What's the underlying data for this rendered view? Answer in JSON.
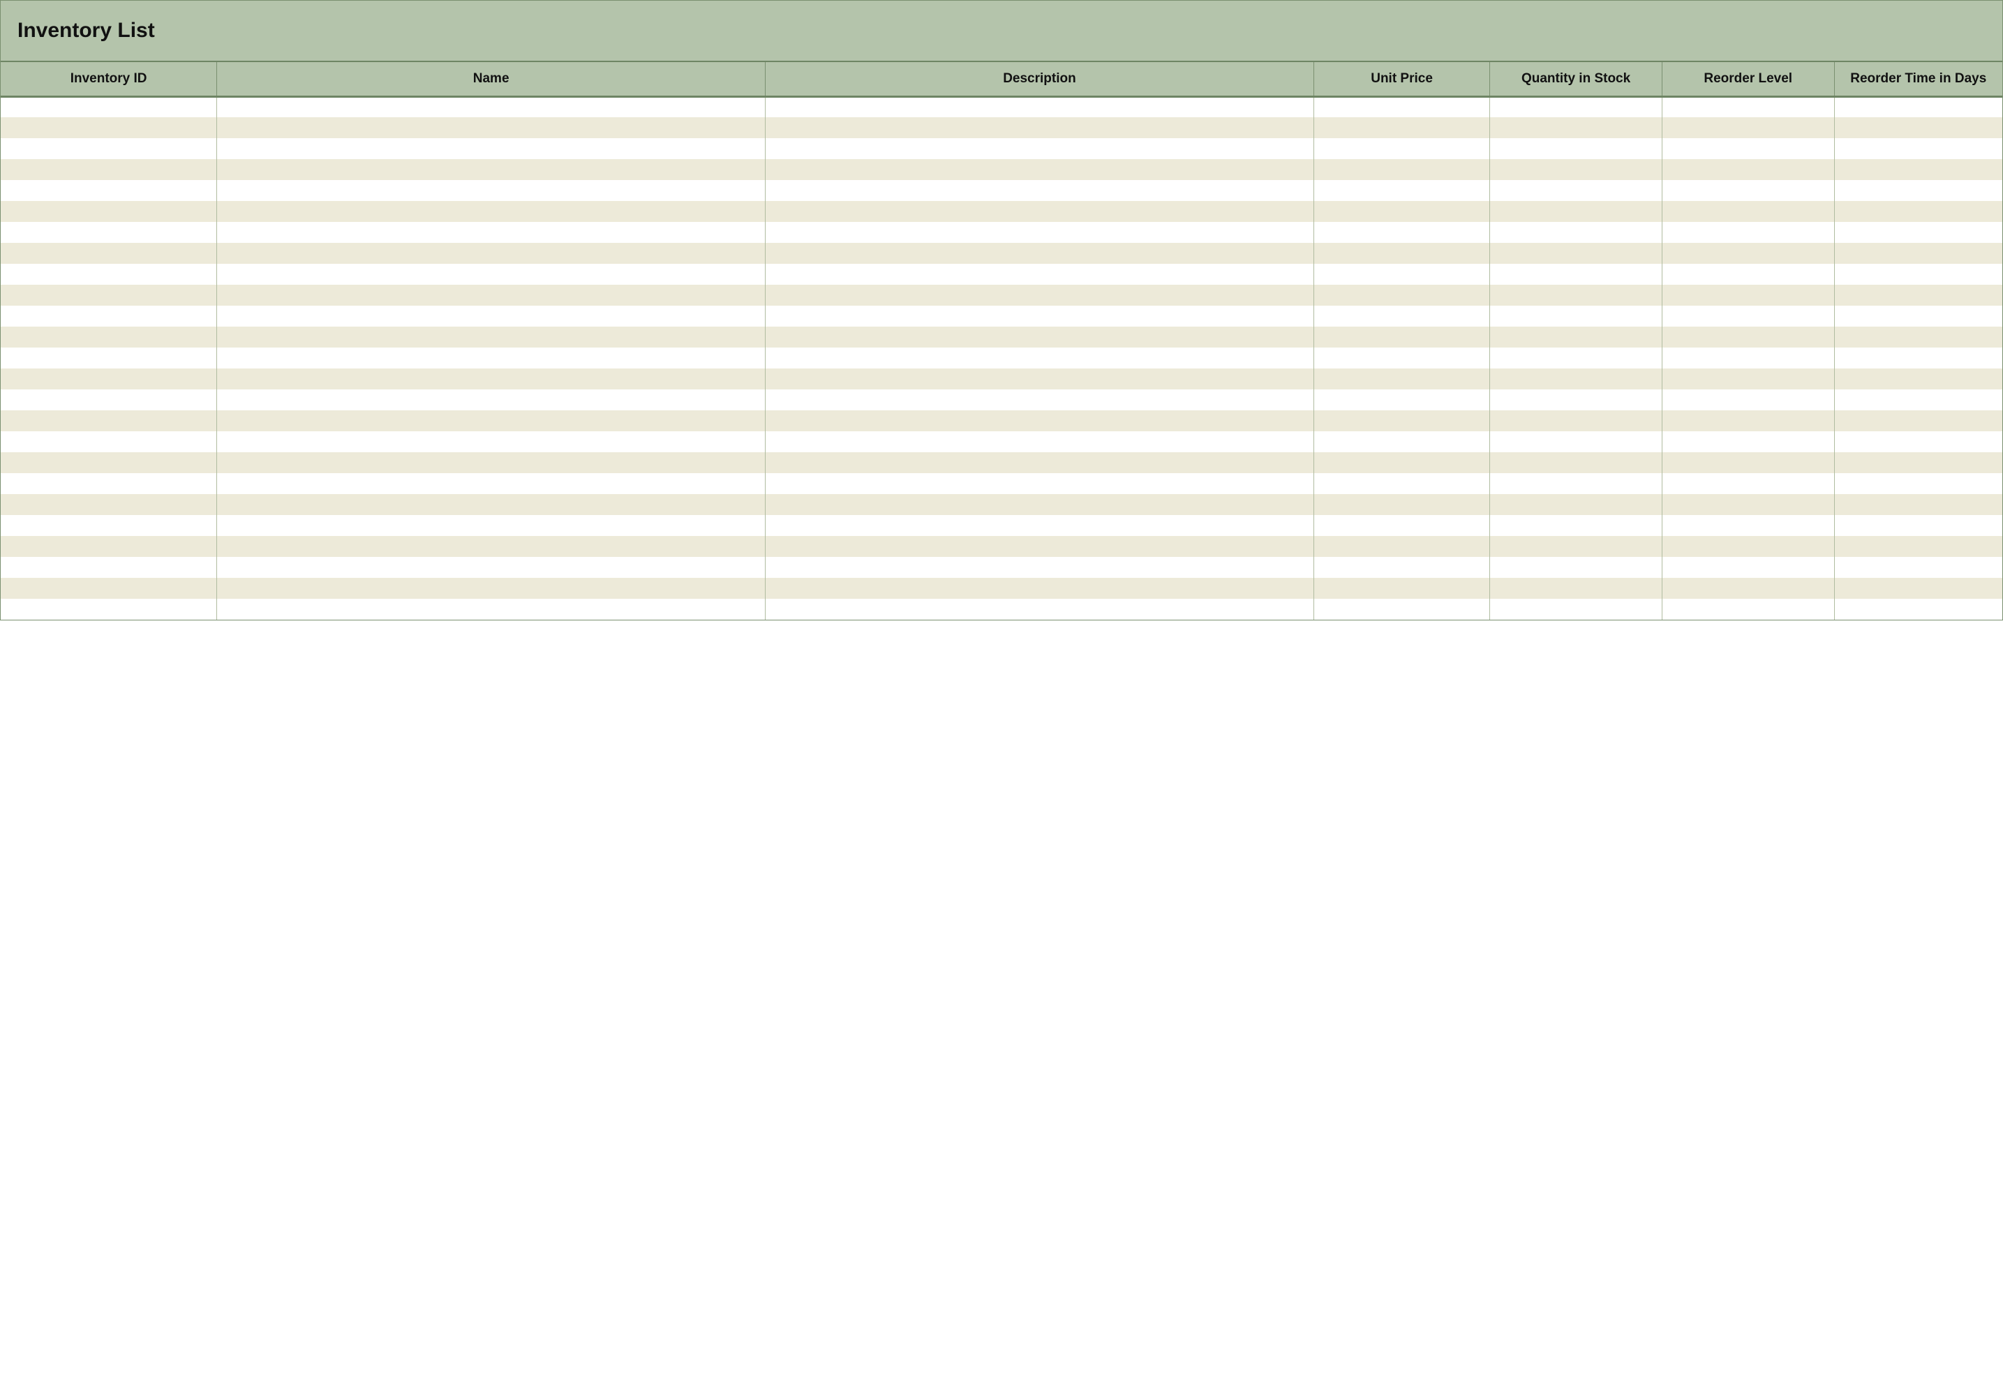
{
  "title": "Inventory List",
  "columns": [
    "Inventory ID",
    "Name",
    "Description",
    "Unit Price",
    "Quantity in Stock",
    "Reorder Level",
    "Reorder Time in Days"
  ],
  "rows": [
    [
      "",
      "",
      "",
      "",
      "",
      "",
      ""
    ],
    [
      "",
      "",
      "",
      "",
      "",
      "",
      ""
    ],
    [
      "",
      "",
      "",
      "",
      "",
      "",
      ""
    ],
    [
      "",
      "",
      "",
      "",
      "",
      "",
      ""
    ],
    [
      "",
      "",
      "",
      "",
      "",
      "",
      ""
    ],
    [
      "",
      "",
      "",
      "",
      "",
      "",
      ""
    ],
    [
      "",
      "",
      "",
      "",
      "",
      "",
      ""
    ],
    [
      "",
      "",
      "",
      "",
      "",
      "",
      ""
    ],
    [
      "",
      "",
      "",
      "",
      "",
      "",
      ""
    ],
    [
      "",
      "",
      "",
      "",
      "",
      "",
      ""
    ],
    [
      "",
      "",
      "",
      "",
      "",
      "",
      ""
    ],
    [
      "",
      "",
      "",
      "",
      "",
      "",
      ""
    ],
    [
      "",
      "",
      "",
      "",
      "",
      "",
      ""
    ],
    [
      "",
      "",
      "",
      "",
      "",
      "",
      ""
    ],
    [
      "",
      "",
      "",
      "",
      "",
      "",
      ""
    ],
    [
      "",
      "",
      "",
      "",
      "",
      "",
      ""
    ],
    [
      "",
      "",
      "",
      "",
      "",
      "",
      ""
    ],
    [
      "",
      "",
      "",
      "",
      "",
      "",
      ""
    ],
    [
      "",
      "",
      "",
      "",
      "",
      "",
      ""
    ],
    [
      "",
      "",
      "",
      "",
      "",
      "",
      ""
    ],
    [
      "",
      "",
      "",
      "",
      "",
      "",
      ""
    ],
    [
      "",
      "",
      "",
      "",
      "",
      "",
      ""
    ],
    [
      "",
      "",
      "",
      "",
      "",
      "",
      ""
    ],
    [
      "",
      "",
      "",
      "",
      "",
      "",
      ""
    ],
    [
      "",
      "",
      "",
      "",
      "",
      "",
      ""
    ]
  ]
}
